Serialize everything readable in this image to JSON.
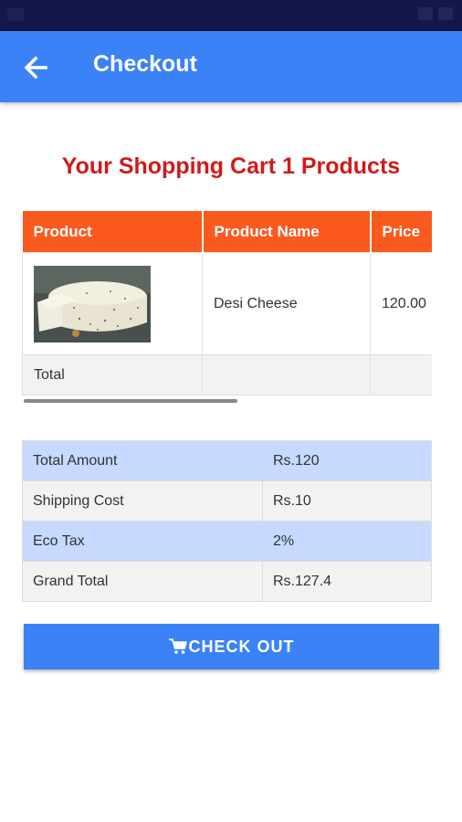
{
  "header": {
    "title": "Checkout",
    "back_icon": "arrow-left-icon"
  },
  "cart": {
    "heading": "Your Shopping Cart 1 Products",
    "columns": [
      "Product",
      "Product Name",
      "Price"
    ],
    "items": [
      {
        "image": "cheese-wheel",
        "name": "Desi Cheese",
        "price": "120.00"
      }
    ],
    "total_label": "Total"
  },
  "summary": {
    "rows": [
      {
        "label": "Total Amount",
        "value": "Rs.120"
      },
      {
        "label": "Shipping Cost",
        "value": "Rs.10"
      },
      {
        "label": "Eco Tax",
        "value": "2%"
      },
      {
        "label": "Grand Total",
        "value": "Rs.127.4"
      }
    ]
  },
  "checkout": {
    "label": "CHECK OUT",
    "icon": "cart-icon"
  },
  "colors": {
    "app_bar": "#3b82f6",
    "heading": "#d11a1a",
    "table_header": "#fb5a1e",
    "summary_blue": "#c5dafe",
    "summary_grey": "#f2f2f2"
  }
}
